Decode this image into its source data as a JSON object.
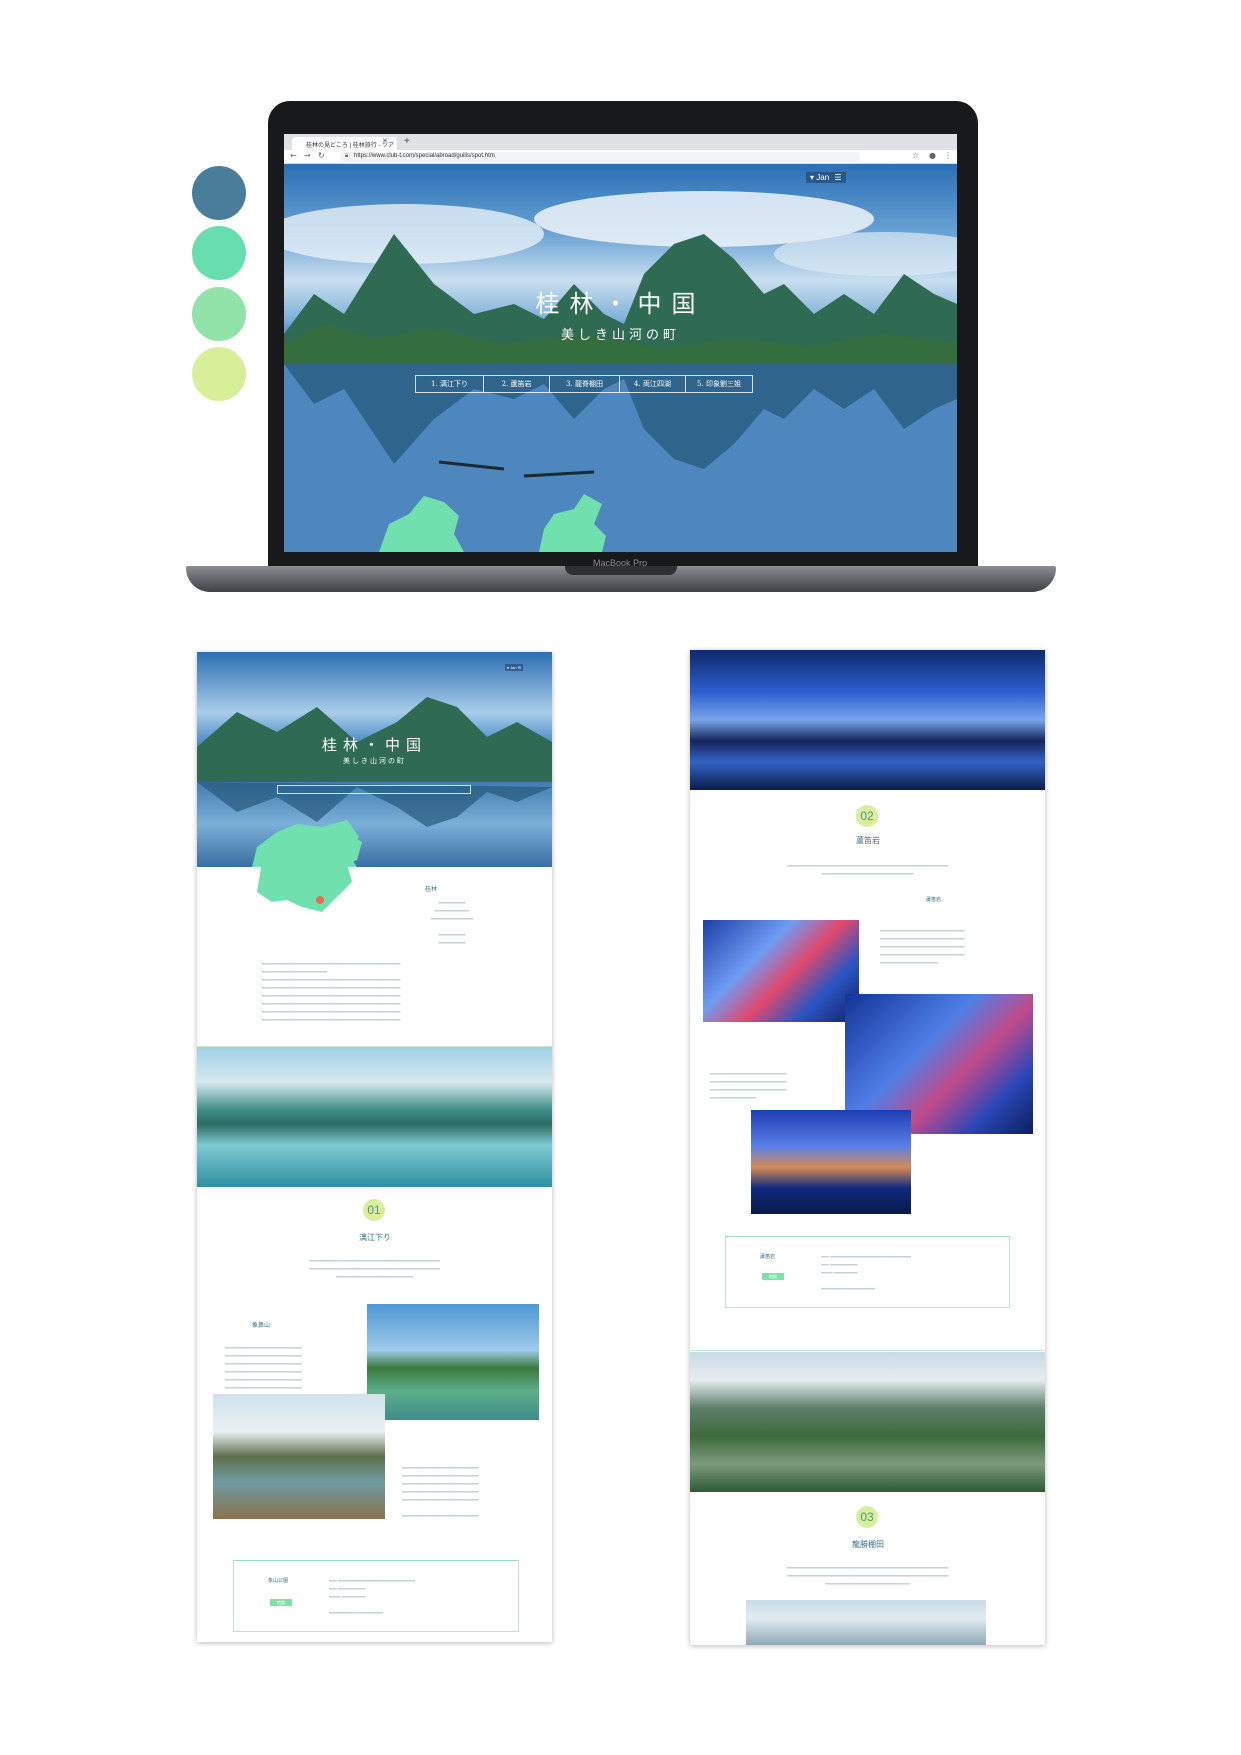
{
  "palette": {
    "colors": [
      "#4a7d99",
      "#68ddb0",
      "#92e3a9",
      "#d8ef9a"
    ]
  },
  "laptop": {
    "model_label": "MacBook Pro"
  },
  "browser": {
    "tab_title": "桂林の見どころ | 桂林旅行 - ツア",
    "url": "https://www.club-t.com/special/abroad/guilis/spot.htm"
  },
  "hero": {
    "title": "桂林・中国",
    "subtitle": "美しき山河の町",
    "lang_label": "▾ Jan",
    "nav": [
      "1. 漓江下り",
      "2. 蘆笛岩",
      "3. 龍脊棚田",
      "4. 両江四湖",
      "5. 印象劉三姐"
    ]
  },
  "mobile_left": {
    "hero_title": "桂林・中国",
    "hero_subtitle": "美しき山河の町",
    "map_heading": "桂林",
    "section1": {
      "number": "01",
      "title": "漓江下り",
      "spot_title": "象鼻山"
    },
    "info": {
      "heading": "象山公園",
      "button": "地図"
    }
  },
  "mobile_right": {
    "section2": {
      "number": "02",
      "title": "蘆笛岩",
      "spot_title": "蘆笛岩"
    },
    "info": {
      "heading": "蘆笛岩",
      "button": "地図"
    },
    "section3": {
      "number": "03",
      "title": "龍勝棚田"
    }
  }
}
